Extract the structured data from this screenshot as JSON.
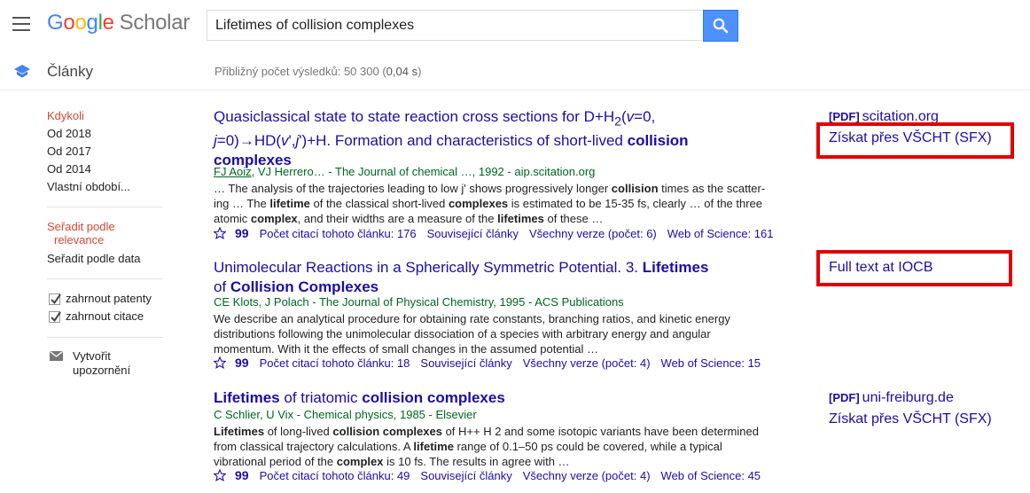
{
  "app": {
    "logo_google": [
      "G",
      "o",
      "o",
      "g",
      "l",
      "e"
    ],
    "logo_scholar": "Scholar",
    "search_value": "Lifetimes of collision complexes"
  },
  "subheader": {
    "section": "Články",
    "results_prefix": "Přibližný počet výsledků: 50 300 (",
    "results_time": "0,04 s",
    "results_suffix": ")"
  },
  "sidebar": {
    "time_filters": [
      "Kdykoli",
      "Od 2018",
      "Od 2017",
      "Od 2014",
      "Vlastní období..."
    ],
    "sort_relevance_line1": "Seřadit podle",
    "sort_relevance_line2": "relevance",
    "sort_date": "Seřadit podle data",
    "include_patents": "zahrnout patenty",
    "include_citations": "zahrnout citace",
    "alert_line1": "Vytvořit",
    "alert_line2": "upozornění"
  },
  "results": [
    {
      "title_html": "Quasiclassical state to state reaction cross sections for D+H<sub>2</sub>(<i>v</i>=0, <i>j</i>=0)→HD(<i>v</i>',<i>j</i>')+H. Formation and characteristics of short-lived <b>collision complexes</b>",
      "authors_underlined": "FJ Aoiz",
      "authors_rest": ", VJ Herrero… - The Journal of chemical …, 1992 - aip.scitation.org",
      "snippet_html": "… The analysis of the trajectories leading to low j' shows progressively longer <b>collision</b> times as the scatter- ing … The <b>lifetime</b> of the classical short-lived <b>complexes</b> is estimated to be 15-35 fs, clearly … of the three atomic <b>complex</b>, and their widths are a measure of the <b>lifetimes</b> of these …",
      "cited_by": "Počet citací tohoto článku: 176",
      "related": "Související články",
      "versions": "Všechny verze (počet: 6)",
      "wos": "Web of Science: 161",
      "side_pdf": "[PDF]",
      "side_source": "scitation.org",
      "side_fulltext": "Získat přes VŠCHT (SFX)"
    },
    {
      "title_html": "Unimolecular Reactions in a Spherically Symmetric Potential. 3. <b>Lifetimes</b> of <b>Collision Complexes</b>",
      "authors_underlined": "",
      "authors_rest": "CE Klots, J Polach - The Journal of Physical Chemistry, 1995 - ACS Publications",
      "snippet_html": "We describe an analytical procedure for obtaining rate constants, branching ratios, and kinetic energy distributions following the unimolecular dissociation of a species with arbitrary energy and angular momentum. With it the effects of small changes in the assumed potential …",
      "cited_by": "Počet citací tohoto článku: 18",
      "related": "Související články",
      "versions": "Všechny verze (počet: 4)",
      "wos": "Web of Science: 15",
      "side_fulltext": "Full text at IOCB"
    },
    {
      "title_html": "<b>Lifetimes</b> of triatomic <b>collision complexes</b>",
      "authors_underlined": "",
      "authors_rest": "C Schlier, U Vix - Chemical physics, 1985 - Elsevier",
      "snippet_html": "<b>Lifetimes</b> of long-lived <b>collision complexes</b> of H++ H 2 and some isotopic variants have been determined from classical trajectory calculations. A <b>lifetime</b> range of 0.1–50 ps could be covered, while a typical vibrational period of the <b>complex</b> is 10 fs. The results in agree with …",
      "cited_by": "Počet citací tohoto článku: 49",
      "related": "Související články",
      "versions": "Všechny verze (počet: 4)",
      "wos": "Web of Science: 45",
      "side_pdf": "[PDF]",
      "side_source": "uni-freiburg.de",
      "side_fulltext": "Získat přes VŠCHT (SFX)"
    }
  ],
  "colors": {
    "accent_red": "#d14836",
    "link_blue": "#1a0dab",
    "source_green": "#006621",
    "search_button": "#4d90fe",
    "highlight_box": "#e00000"
  },
  "icons": [
    "menu-icon",
    "search-icon",
    "articles-icon",
    "envelope-icon",
    "star-icon",
    "quote-icon",
    "checkmark-icon"
  ]
}
